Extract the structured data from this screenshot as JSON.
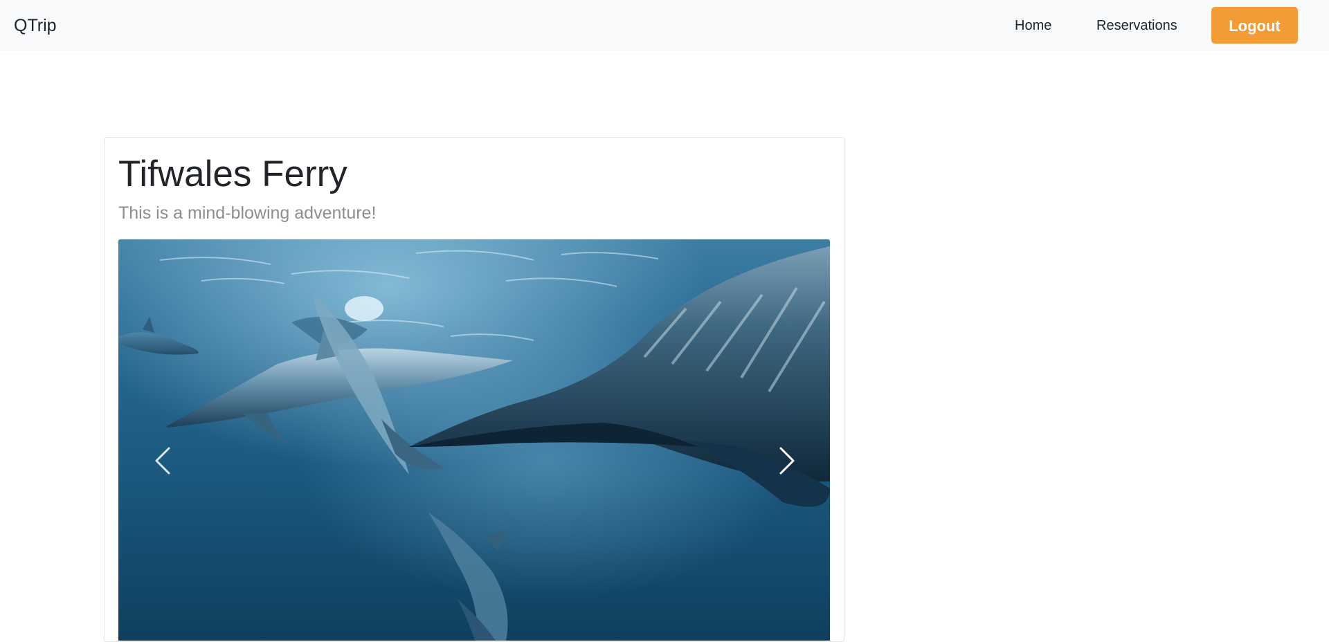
{
  "navbar": {
    "brand": "QTrip",
    "links": [
      {
        "label": "Home"
      },
      {
        "label": "Reservations"
      }
    ],
    "logout_label": "Logout",
    "logout_color": "#f39c35"
  },
  "adventure": {
    "title": "Tifwales Ferry",
    "subtitle": "This is a mind-blowing adventure!",
    "gallery": {
      "image_subject": "dolphins swimming underwater",
      "prev_icon": "chevron-left-icon",
      "next_icon": "chevron-right-icon"
    }
  }
}
